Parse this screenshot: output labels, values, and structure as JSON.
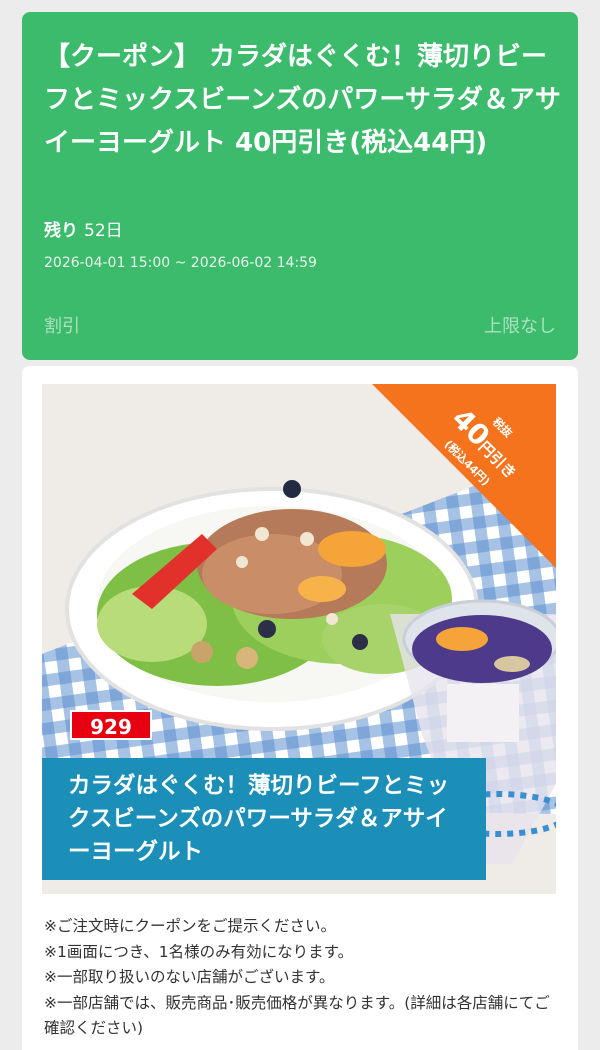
{
  "coupon": {
    "title": "【クーポン】 カラダはぐくむ！薄切りビーフとミックスビーンズのパワーサラダ＆アサイーヨーグルト 40円引き(税込44円)",
    "remaining_label": "残り",
    "remaining_days": "52日",
    "period": "2026-04-01 15:00 ~ 2026-06-02 14:59",
    "discount_type": "割引",
    "limit": "上限なし"
  },
  "promo": {
    "ribbon_top": "税抜",
    "ribbon_amount": "40",
    "ribbon_unit": "円引き",
    "ribbon_sub": "(税込44円)",
    "item_number": "929",
    "item_name": "カラダはぐくむ！薄切りビーフとミックスビーンズのパワーサラダ＆アサイーヨーグルト"
  },
  "notes": [
    "※ご注文時にクーポンをご提示ください。",
    "※1画面につき、1名様のみ有効になります。",
    "※一部取り扱いのない店舗がございます。",
    "※一部店舗では、販売商品･販売価格が異なります。(詳細は各店舗にてご確認ください)"
  ],
  "colors": {
    "header_green": "#3dbb6c",
    "ribbon_orange": "#f5731c",
    "badge_red": "#e60012",
    "banner_blue": "#1b8fb8"
  }
}
